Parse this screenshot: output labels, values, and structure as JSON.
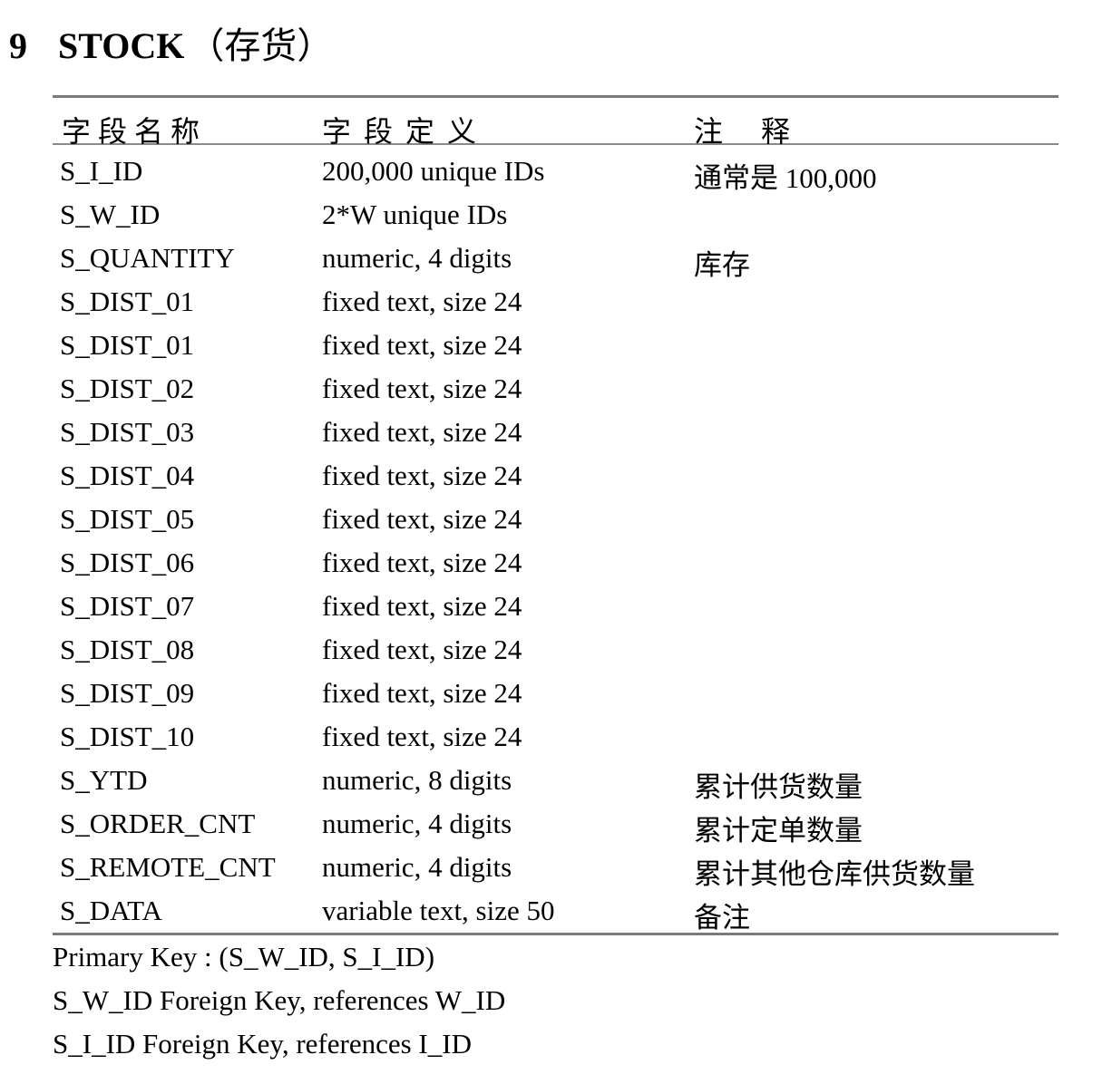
{
  "heading": {
    "number": "9",
    "title": "STOCK",
    "subtitle": "（存货）"
  },
  "table": {
    "columns": [
      "字段名称",
      "字段定义",
      "注释"
    ],
    "rows": [
      {
        "field": "S_I_ID",
        "definition": "200,000 unique IDs",
        "comment": "通常是 100,000"
      },
      {
        "field": "S_W_ID",
        "definition": "2*W unique IDs",
        "comment": ""
      },
      {
        "field": "S_QUANTITY",
        "definition": "numeric, 4 digits",
        "comment": "库存"
      },
      {
        "field": "S_DIST_01",
        "definition": "fixed text, size 24",
        "comment": ""
      },
      {
        "field": "S_DIST_01",
        "definition": "fixed text, size 24",
        "comment": ""
      },
      {
        "field": "S_DIST_02",
        "definition": "fixed text, size 24",
        "comment": ""
      },
      {
        "field": "S_DIST_03",
        "definition": "fixed text, size 24",
        "comment": ""
      },
      {
        "field": "S_DIST_04",
        "definition": "fixed text, size 24",
        "comment": ""
      },
      {
        "field": "S_DIST_05",
        "definition": "fixed text, size 24",
        "comment": ""
      },
      {
        "field": "S_DIST_06",
        "definition": "fixed text, size 24",
        "comment": ""
      },
      {
        "field": "S_DIST_07",
        "definition": "fixed text, size 24",
        "comment": ""
      },
      {
        "field": "S_DIST_08",
        "definition": "fixed text, size 24",
        "comment": ""
      },
      {
        "field": "S_DIST_09",
        "definition": "fixed text, size 24",
        "comment": ""
      },
      {
        "field": "S_DIST_10",
        "definition": "fixed text, size 24",
        "comment": ""
      },
      {
        "field": "S_YTD",
        "definition": "numeric, 8 digits",
        "comment": "累计供货数量"
      },
      {
        "field": "S_ORDER_CNT",
        "definition": "numeric, 4 digits",
        "comment": "累计定单数量"
      },
      {
        "field": "S_REMOTE_CNT",
        "definition": "numeric, 4 digits",
        "comment": "累计其他仓库供货数量"
      },
      {
        "field": "S_DATA",
        "definition": "variable text, size 50",
        "comment": "备注"
      }
    ]
  },
  "notes": [
    "Primary Key : (S_W_ID, S_I_ID)",
    "S_W_ID Foreign Key, references W_ID",
    "S_I_ID Foreign Key, references I_ID"
  ]
}
